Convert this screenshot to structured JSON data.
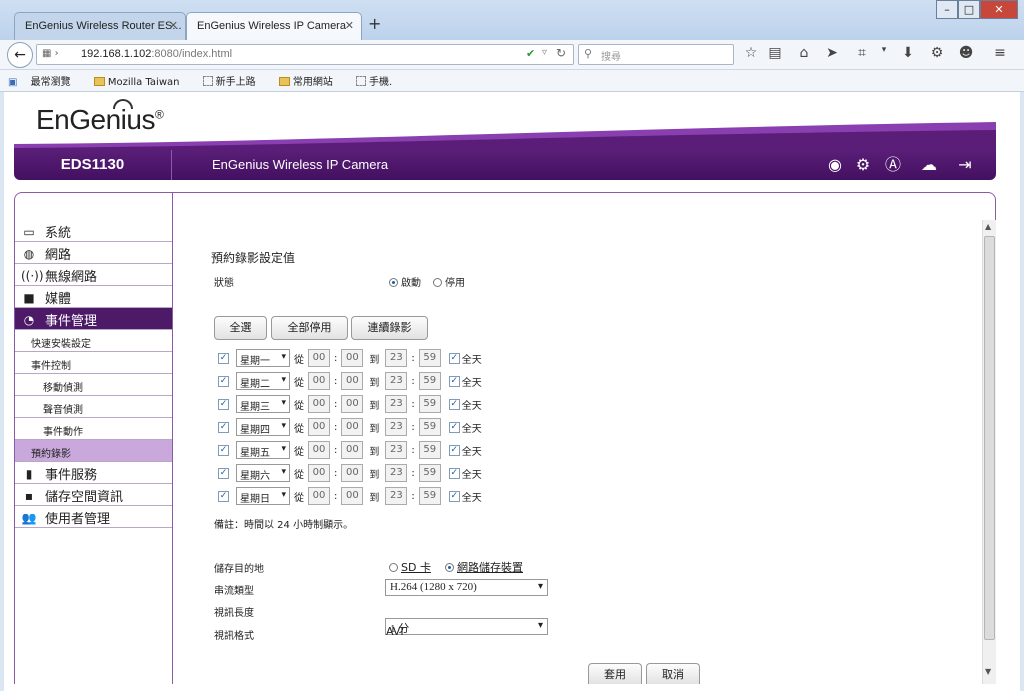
{
  "browser": {
    "tabs": [
      {
        "label": "EnGenius Wireless Router ES..."
      },
      {
        "label": "EnGenius Wireless IP Camera"
      }
    ],
    "url_host": "192.168.1.102",
    "url_rest": ":8080/index.html",
    "search_placeholder": "搜尋",
    "bookmarks": [
      "最常瀏覽",
      "Mozilla Taiwan",
      "新手上路",
      "常用網站",
      "手機."
    ]
  },
  "brand": {
    "logo": "EnGenius",
    "logo_mark": "®",
    "model": "EDS1130",
    "title": "EnGenius Wireless IP Camera"
  },
  "sidebar": {
    "items": [
      {
        "label": "系統",
        "icon": "monitor-icon"
      },
      {
        "label": "網路",
        "icon": "globe-icon"
      },
      {
        "label": "無線網路",
        "icon": "wireless-icon"
      },
      {
        "label": "媒體",
        "icon": "camera-icon"
      },
      {
        "label": "事件管理",
        "icon": "event-icon"
      }
    ],
    "subitems": [
      "快速安裝設定",
      "事件控制",
      "移動偵測",
      "聲音偵測",
      "事件動作",
      "預約錄影"
    ],
    "bottom": [
      {
        "label": "事件服務",
        "icon": "service-icon"
      },
      {
        "label": "儲存空間資訊",
        "icon": "storage-icon"
      },
      {
        "label": "使用者管理",
        "icon": "users-icon"
      }
    ]
  },
  "schedule": {
    "title": "預約錄影設定值",
    "status_label": "狀態",
    "enable": "啟動",
    "disable": "停用",
    "buttons": [
      "全選",
      "全部停用",
      "連續錄影"
    ],
    "from": "從",
    "to": "到",
    "colon": ":",
    "allday": "全天",
    "days": [
      "星期一",
      "星期二",
      "星期三",
      "星期四",
      "星期五",
      "星期六",
      "星期日"
    ],
    "start_h": "00",
    "start_m": "00",
    "end_h": "23",
    "end_m": "59",
    "note": "備註：時間以 24 小時制顯示。"
  },
  "storage": {
    "dest_label": "儲存目的地",
    "sd": "SD 卡",
    "nas": "網路儲存裝置",
    "stream_label": "串流類型",
    "stream_value": "H.264 (1280 x 720)",
    "length_label": "視訊長度",
    "length_value": "1 分",
    "format_label": "視訊格式",
    "format_value": "AVI"
  },
  "actions": {
    "apply": "套用",
    "cancel": "取消"
  }
}
